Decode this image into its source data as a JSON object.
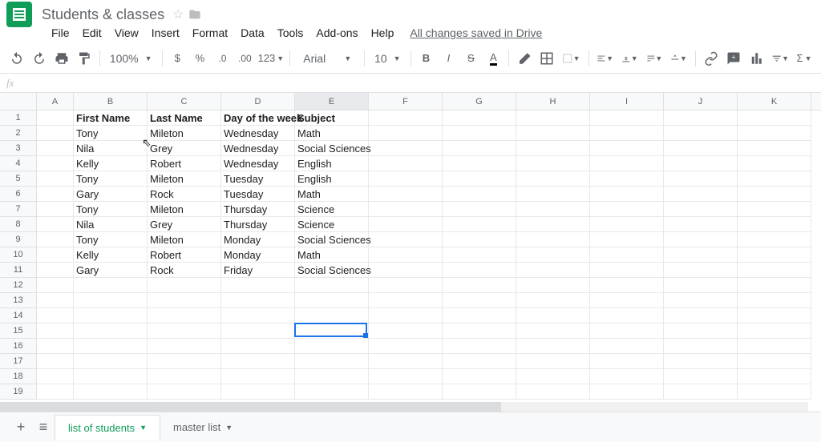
{
  "doc": {
    "title": "Students & classes",
    "save_status": "All changes saved in Drive"
  },
  "menu": {
    "file": "File",
    "edit": "Edit",
    "view": "View",
    "insert": "Insert",
    "format": "Format",
    "data": "Data",
    "tools": "Tools",
    "addons": "Add-ons",
    "help": "Help"
  },
  "toolbar": {
    "zoom": "100%",
    "font": "Arial",
    "size": "10",
    "fmt123": "123"
  },
  "fx": {
    "label": "fx"
  },
  "columns": [
    {
      "letter": "A",
      "w": 46
    },
    {
      "letter": "B",
      "w": 92
    },
    {
      "letter": "C",
      "w": 92
    },
    {
      "letter": "D",
      "w": 92
    },
    {
      "letter": "E",
      "w": 92
    },
    {
      "letter": "F",
      "w": 92
    },
    {
      "letter": "G",
      "w": 92
    },
    {
      "letter": "H",
      "w": 92
    },
    {
      "letter": "I",
      "w": 92
    },
    {
      "letter": "J",
      "w": 92
    },
    {
      "letter": "K",
      "w": 92
    }
  ],
  "row_count": 19,
  "headers": {
    "b": "First Name",
    "c": "Last Name",
    "d": "Day of the week",
    "e": "Subject"
  },
  "rows": [
    {
      "b": "Tony",
      "c": "Mileton",
      "d": "Wednesday",
      "e": "Math"
    },
    {
      "b": "Nila",
      "c": "Grey",
      "d": "Wednesday",
      "e": "Social Sciences"
    },
    {
      "b": "Kelly",
      "c": "Robert",
      "d": "Wednesday",
      "e": "English"
    },
    {
      "b": "Tony",
      "c": "Mileton",
      "d": "Tuesday",
      "e": "English"
    },
    {
      "b": "Gary",
      "c": "Rock",
      "d": "Tuesday",
      "e": "Math"
    },
    {
      "b": "Tony",
      "c": "Mileton",
      "d": "Thursday",
      "e": "Science"
    },
    {
      "b": "Nila",
      "c": "Grey",
      "d": "Thursday",
      "e": "Science"
    },
    {
      "b": "Tony",
      "c": "Mileton",
      "d": "Monday",
      "e": "Social Sciences"
    },
    {
      "b": "Kelly",
      "c": "Robert",
      "d": "Monday",
      "e": "Math"
    },
    {
      "b": "Gary",
      "c": "Rock",
      "d": "Friday",
      "e": "Social Sciences"
    }
  ],
  "selected_cell": {
    "col": "E",
    "row": 15
  },
  "sheets": {
    "active": "list of students",
    "other": "master list"
  }
}
